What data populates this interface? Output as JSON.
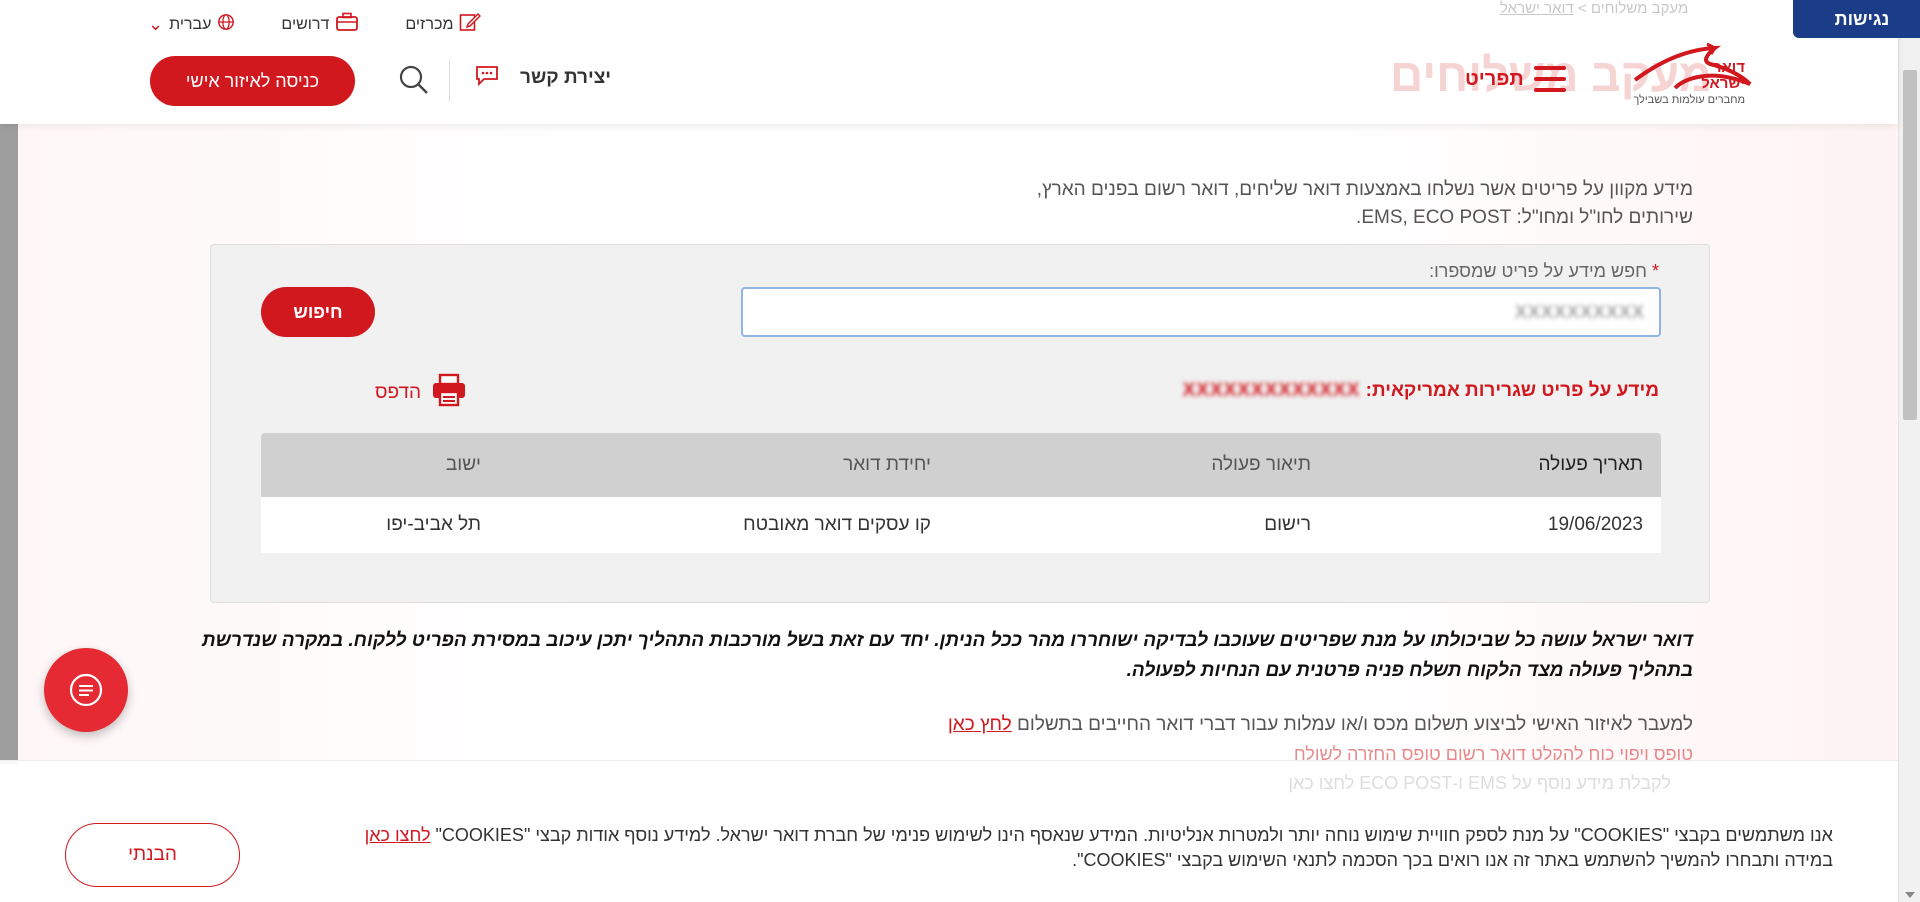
{
  "header": {
    "accessibility_label": "נגישות",
    "breadcrumb_home": "דואר ישראל",
    "breadcrumb_sep": ">",
    "breadcrumb_current": "מעקב משלוחים",
    "ghost_title": "מעקב משלוחים",
    "logo_text_line1": "דואר",
    "logo_text_line2": "ישראל",
    "logo_tagline": "מחברים עולמות בשבילך",
    "menu_label": "תפריט",
    "links": [
      {
        "label": "מכרזים",
        "icon": "edit-icon"
      },
      {
        "label": "דרושים",
        "icon": "briefcase-icon"
      },
      {
        "label": "עברית",
        "icon": "globe-icon"
      }
    ],
    "login_label": "כניסה לאיזור אישי",
    "contact_label": "יצירת קשר"
  },
  "intro": {
    "line1": "מידע מקוון על פריטים אשר נשלחו באמצעות דואר שליחים, דואר רשום בפנים הארץ,",
    "line2": "שירותים לחו\"ל ומחו\"ל: EMS, ECO POST."
  },
  "search": {
    "required_mark": "*",
    "label": "חפש מידע על פריט שמספרו:",
    "value": "XXXXXXXXXX",
    "button_label": "חיפוש"
  },
  "result": {
    "title": "מידע על פריט שגרירות אמריקאית:",
    "item_number": "XXXXXXXXXXXXX",
    "print_label": "הדפס",
    "columns": [
      "תאריך פעולה",
      "תיאור פעולה",
      "יחידת דואר",
      "ישוב"
    ],
    "rows": [
      [
        "19/06/2023",
        "רישום",
        "קו עסקים דואר מאובטח",
        "תל אביב-יפו"
      ]
    ]
  },
  "notice": {
    "text": "דואר ישראל עושה כל שביכולתו על מנת שפריטים שעוכבו לבדיקה ישוחררו מהר ככל הניתן. יחד עם זאת בשל מורכבות התהליך יתכן עיכוב במסירת הפריט ללקוח. במקרה שנדרשת בתהליך פעולה מצד הלקוח תשלח פניה פרטנית עם הנחיות לפעולה."
  },
  "links": {
    "personal_area_text": "למעבר לאיזור האישי לביצוע תשלום מכס ו/או עמלות עבור דברי דואר החייבים בתשלום",
    "personal_area_link": "לחץ כאן",
    "return_form_link": "טופס ויפוי כוח להקלט דואר רשום טופס החזרה לשולח"
  },
  "cookies": {
    "ghost_line": "לקבלת מידע נוסף על EMS ו-ECO POST לחצו כאן",
    "text_line1": "אנו משתמשים בקבצי \"COOKIES\" על מנת לספק חוויית שימוש נוחה יותר ולמטרות אנליטיות. המידע שנאסף הינו לשימוש פנימי של חברת דואר ישראל. למידע נוסף אודות קבצי \"COOKIES\"",
    "link": "לחצו כאן",
    "text_line2": "במידה ותבחרו להמשיך להשתמש באתר זה אנו רואים בכך הסכמה לתנאי השימוש בקבצי \"COOKIES\".",
    "button_label": "הבנתי"
  },
  "colors": {
    "brand_red": "#d1181f",
    "accessibility_blue": "#1b3c87",
    "panel_bg": "#f1f1f1",
    "table_header": "#d0d0d0"
  }
}
